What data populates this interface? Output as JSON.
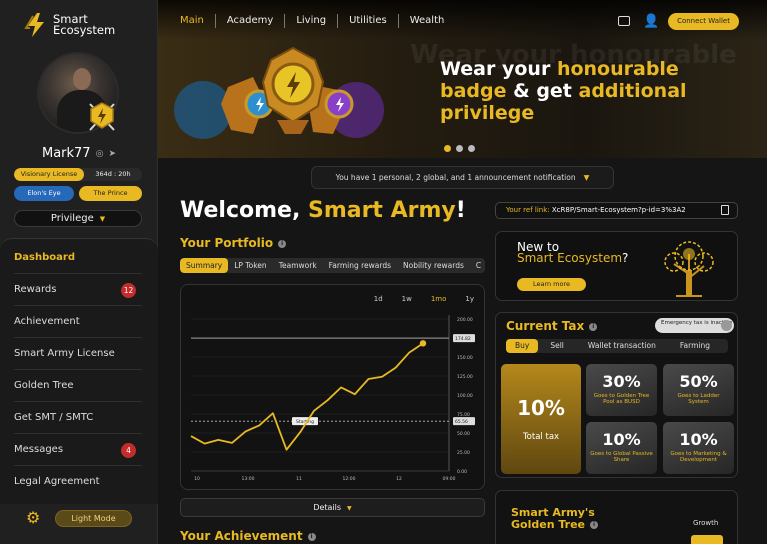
{
  "brand": {
    "line1": "Smart",
    "line2": "Ecosystem"
  },
  "profile": {
    "username": "Mark77",
    "license_name": "Visionary License",
    "license_time": "364d : 20h",
    "tag_blue": "Elon's Eye",
    "tag_yellow": "The Prince",
    "privilege_label": "Privilege"
  },
  "sidebar": {
    "items": [
      {
        "label": "Dashboard",
        "active": true
      },
      {
        "label": "Rewards",
        "badge": "12"
      },
      {
        "label": "Achievement"
      },
      {
        "label": "Smart Army License"
      },
      {
        "label": "Golden Tree"
      },
      {
        "label": "Get SMT / SMTC"
      },
      {
        "label": "Messages",
        "badge": "4"
      },
      {
        "label": "Legal Agreement"
      }
    ],
    "light_mode_label": "Light Mode"
  },
  "topnav": {
    "items": [
      "Main",
      "Academy",
      "Living",
      "Utilities",
      "Wealth"
    ],
    "connect_label": "Connect Wallet"
  },
  "hero": {
    "bg_text": "Wear your honourable",
    "l1a": "Wear your ",
    "l1b": "honourable",
    "l2a": "badge",
    "l2b": " & get ",
    "l2c": "additional",
    "l3": "privilege"
  },
  "notification": "You have 1 personal, 2 global, and 1 announcement notification",
  "welcome": {
    "prefix": "Welcome, ",
    "name": "Smart Army",
    "suffix": "!"
  },
  "reflink": {
    "label": "Your ref link:",
    "value": "XcR8P/Smart-Ecosystem?p-id=3%3A2"
  },
  "portfolio": {
    "title": "Your Portfolio",
    "tabs": [
      "Summary",
      "LP Token",
      "Teamwork",
      "Farming rewards",
      "Nobility rewards",
      "C"
    ],
    "ranges": [
      "1d",
      "1w",
      "1mo",
      "1y"
    ],
    "active_range": "1mo",
    "details_label": "Details"
  },
  "chart_data": {
    "type": "line",
    "x_ticks": [
      "10",
      "13:00",
      "11",
      "12:00",
      "12",
      "09:00"
    ],
    "y_ticks": [
      "200.00",
      "175.00",
      "150.00",
      "125.00",
      "100.00",
      "75.00",
      "50.00",
      "25.00",
      "0.00"
    ],
    "ylim": [
      0,
      200
    ],
    "series": [
      {
        "values": [
          46,
          36,
          41,
          37,
          52,
          60,
          76,
          28,
          51,
          79,
          93,
          110,
          101,
          121,
          124,
          136,
          156,
          168
        ]
      }
    ],
    "high_label": "174.82",
    "start_label": "Starting",
    "start_value": "65.56",
    "grid": true
  },
  "achievement_title": "Your Achievement",
  "newto": {
    "line1": "New to",
    "line2a": "Smart Ecosystem",
    "line2b": "?",
    "learn_label": "Learn more"
  },
  "tax": {
    "title": "Current Tax",
    "emergency": "Emergency tax is inactive",
    "tabs": [
      "Buy",
      "Sell",
      "Wallet transaction",
      "Farming"
    ],
    "total_value": "10%",
    "total_label": "Total tax",
    "cells": [
      {
        "pct": "30%",
        "desc": "Goes to Golden Tree Pool as BUSD"
      },
      {
        "pct": "50%",
        "desc": "Goes to Ladder System"
      },
      {
        "pct": "10%",
        "desc": "Goes to Global Passive Share"
      },
      {
        "pct": "10%",
        "desc": "Goes to Marketing & Development"
      }
    ]
  },
  "golden": {
    "title": "Smart Army's Golden Tree",
    "growth_label": "Growth"
  },
  "colors": {
    "accent": "#e8b923",
    "panel": "#121212",
    "sidebar": "#202020",
    "badge_red": "#c42b2b",
    "tag_blue": "#2569b8"
  }
}
